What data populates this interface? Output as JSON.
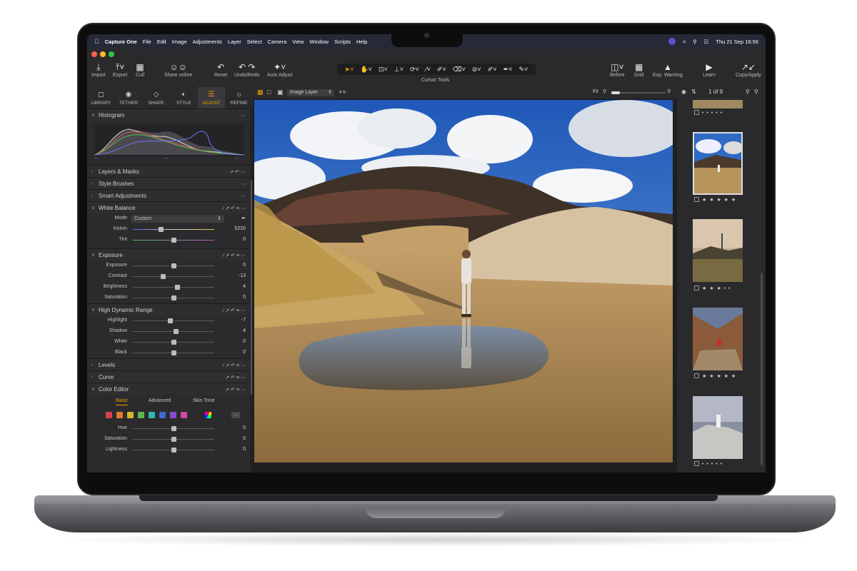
{
  "menubar": {
    "app": "Capture One",
    "items": [
      "File",
      "Edit",
      "Image",
      "Adjustments",
      "Layer",
      "Select",
      "Camera",
      "View",
      "Window",
      "Scripts",
      "Help"
    ],
    "clock": "Thu 21 Sep  16:56"
  },
  "toolbar": {
    "import": "Import",
    "export": "Export",
    "cull": "Cull",
    "share": "Share online",
    "reset": "Reset",
    "undo_redo": "Undo/Redo",
    "auto_adjust": "Auto Adjust",
    "cursor_tools": "Cursor Tools",
    "before": "Before",
    "grid": "Grid",
    "exp_warning": "Exp. Warning",
    "learn": "Learn",
    "copy_apply": "Copy/Apply"
  },
  "tooltabs": [
    "LIBRARY",
    "TETHER",
    "SHAPE",
    "STYLE",
    "ADJUST",
    "REFINE"
  ],
  "histogram": {
    "title": "Histogram",
    "lo": "--",
    "mid": "--",
    "hi": "--"
  },
  "sections": {
    "layers": "Layers & Masks",
    "brushes": "Style Brushes",
    "smart": "Smart Adjustments",
    "wb": "White Balance",
    "exposure": "Exposure",
    "hdr": "High Dynamic Range",
    "levels": "Levels",
    "curve": "Curve",
    "color_editor": "Color Editor"
  },
  "white_balance": {
    "mode_label": "Mode",
    "mode_value": "Custom",
    "kelvin_label": "Kelvin",
    "kelvin": "5220",
    "tint_label": "Tint",
    "tint": "0"
  },
  "exposure": [
    {
      "label": "Exposure",
      "value": "0",
      "pos": 0.5
    },
    {
      "label": "Contrast",
      "value": "-13",
      "pos": 0.37
    },
    {
      "label": "Brightness",
      "value": "4",
      "pos": 0.54
    },
    {
      "label": "Saturation",
      "value": "0",
      "pos": 0.5
    }
  ],
  "hdr": [
    {
      "label": "Highlight",
      "value": "-7",
      "pos": 0.46
    },
    {
      "label": "Shadow",
      "value": "4",
      "pos": 0.53
    },
    {
      "label": "White",
      "value": "0",
      "pos": 0.5
    },
    {
      "label": "Black",
      "value": "0",
      "pos": 0.5
    }
  ],
  "color_editor": {
    "tabs": [
      "Basic",
      "Advanced",
      "Skin Tone"
    ],
    "swatch_colors": [
      "#d9404a",
      "#e07a2e",
      "#d7b52a",
      "#5fb84a",
      "#2fb7b0",
      "#3b6ad8",
      "#8a4ad0",
      "#d247a0"
    ],
    "more": "...",
    "rows": [
      {
        "label": "Hue",
        "value": "0"
      },
      {
        "label": "Saturation",
        "value": "0"
      },
      {
        "label": "Lightness",
        "value": "0"
      }
    ]
  },
  "viewer": {
    "layer": "Image Layer",
    "fit": "Fit"
  },
  "browser": {
    "counter": "1 of 9"
  },
  "thumbs": [
    {
      "stars": "• • • • •"
    },
    {
      "stars": "★ ★ ★ ★ ★"
    },
    {
      "stars": "★ ★ ★ • •"
    },
    {
      "stars": "★ ★ ★ ★ ★"
    },
    {
      "stars": "• • • • •"
    }
  ],
  "colors": {
    "accent": "#f0a000",
    "panel": "#2b2b2d",
    "menubar": "#252a36"
  }
}
